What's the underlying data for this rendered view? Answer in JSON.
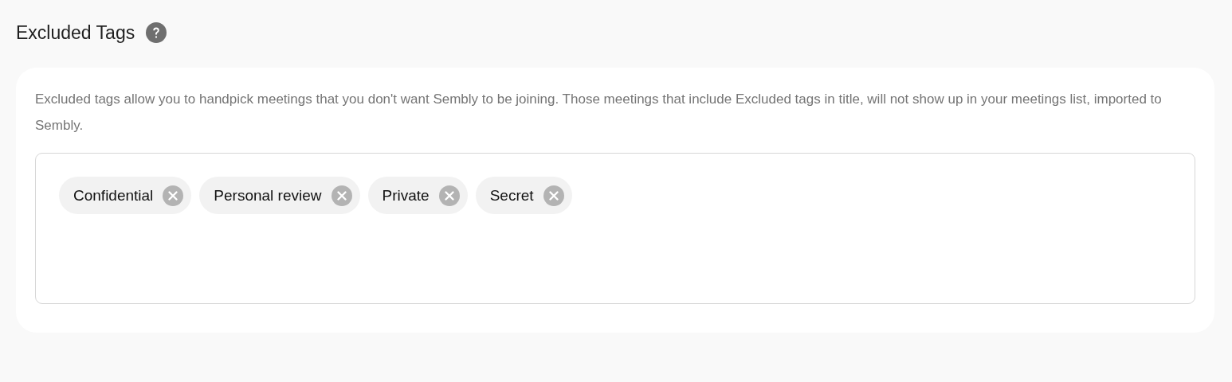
{
  "section": {
    "title": "Excluded Tags",
    "description": "Excluded tags allow you to handpick meetings that you don't want Sembly to be joining. Those meetings that include Excluded tags in title, will not show up in your meetings list, imported to Sembly."
  },
  "tags": [
    {
      "label": "Confidential"
    },
    {
      "label": "Personal review"
    },
    {
      "label": "Private"
    },
    {
      "label": "Secret"
    }
  ]
}
